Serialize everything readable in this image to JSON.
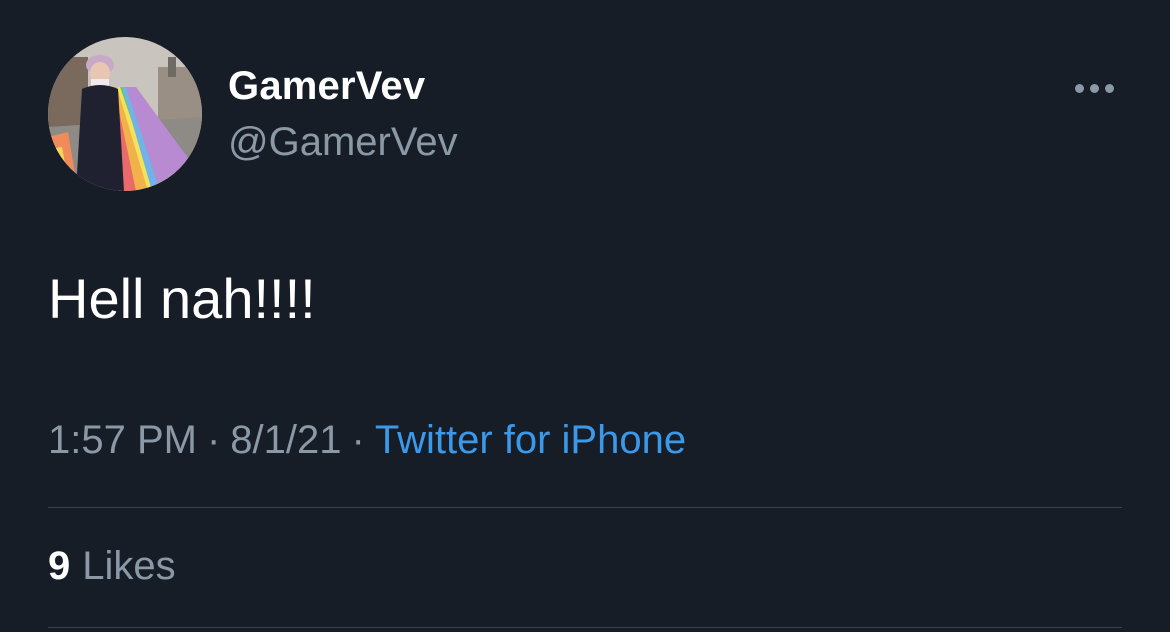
{
  "author": {
    "display_name": "GamerVev",
    "handle": "@GamerVev",
    "avatar_icon": "profile-photo"
  },
  "tweet": {
    "text": "Hell nah!!!!"
  },
  "meta": {
    "time": "1:57 PM",
    "separator": "·",
    "date": "8/1/21",
    "source": "Twitter for iPhone"
  },
  "stats": {
    "likes_count": "9",
    "likes_label": "Likes"
  },
  "colors": {
    "background": "#161d27",
    "primary_text": "#ffffff",
    "secondary_text": "#8b98a5",
    "link": "#3c98e8",
    "divider": "#38444d"
  }
}
